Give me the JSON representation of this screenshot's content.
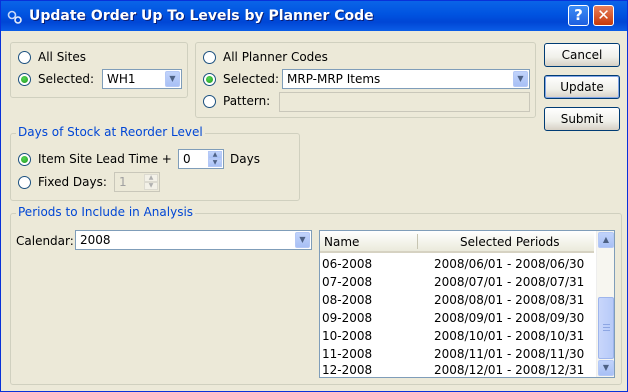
{
  "window": {
    "title": "Update Order Up To Levels by Planner Code",
    "help_label": "?",
    "close_label": "✕"
  },
  "sites": {
    "all_label": "All Sites",
    "selected_label": "Selected:",
    "selected_value": "WH1",
    "selected_checked": true
  },
  "planner": {
    "all_label": "All Planner Codes",
    "selected_label": "Selected:",
    "selected_value": "MRP-MRP Items",
    "pattern_label": "Pattern:",
    "pattern_value": "",
    "selected_checked": true
  },
  "days_stock": {
    "group_label": "Days of Stock at Reorder Level",
    "lead_time_label": "Item Site Lead Time +",
    "lead_time_value": "0",
    "days_unit": "Days",
    "fixed_label": "Fixed Days:",
    "fixed_value": "1",
    "lead_time_checked": true
  },
  "periods": {
    "group_label": "Periods to Include in Analysis",
    "calendar_label": "Calendar:",
    "calendar_value": "2008",
    "columns": [
      "Name",
      "Selected Periods"
    ],
    "rows": [
      {
        "name": "06-2008",
        "range": "2008/06/01 - 2008/06/30"
      },
      {
        "name": "07-2008",
        "range": "2008/07/01 - 2008/07/31"
      },
      {
        "name": "08-2008",
        "range": "2008/08/01 - 2008/08/31"
      },
      {
        "name": "09-2008",
        "range": "2008/09/01 - 2008/09/30"
      },
      {
        "name": "10-2008",
        "range": "2008/10/01 - 2008/10/31"
      },
      {
        "name": "11-2008",
        "range": "2008/11/01 - 2008/11/30"
      },
      {
        "name": "12-2008",
        "range": "2008/12/01 - 2008/12/31"
      }
    ]
  },
  "buttons": {
    "cancel": "Cancel",
    "update": "Update",
    "submit": "Submit"
  },
  "icons": {
    "app": "gears-icon",
    "dropdown": "chevron-down-icon",
    "spin_up": "spin-up-icon",
    "spin_down": "spin-down-icon",
    "scroll_up": "scroll-up-icon",
    "scroll_down": "scroll-down-icon"
  }
}
